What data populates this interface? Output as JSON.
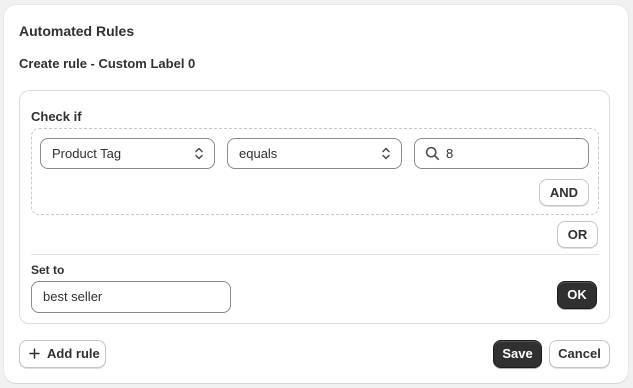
{
  "header": {
    "title": "Automated Rules",
    "subtitle": "Create rule - Custom Label 0"
  },
  "rule": {
    "check_label": "Check if",
    "condition": {
      "field": "Product Tag",
      "operator": "equals",
      "value": "8"
    },
    "and_label": "AND",
    "or_label": "OR",
    "set_to_label": "Set to",
    "set_to_value": "best seller",
    "ok_label": "OK"
  },
  "footer": {
    "add_rule_label": "Add rule",
    "save_label": "Save",
    "cancel_label": "Cancel"
  },
  "icons": {
    "select_chevron": "chevron-up-down-icon",
    "search": "search-icon",
    "add": "plus-icon"
  },
  "colors": {
    "primary_button": "#303030",
    "border": "#8a8a8a",
    "background": "#f1f1f1"
  }
}
